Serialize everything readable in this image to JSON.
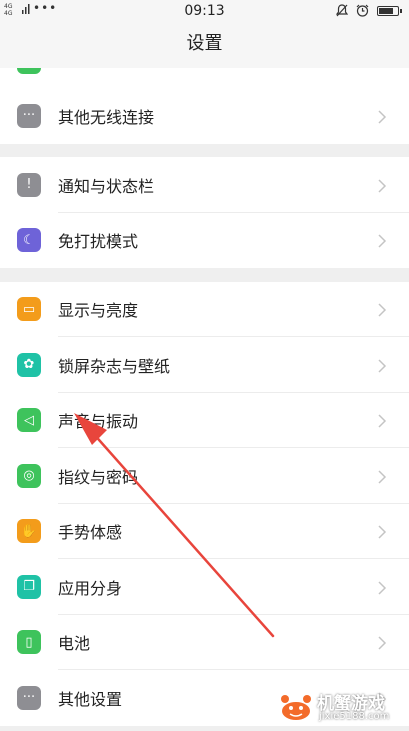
{
  "status_bar": {
    "network_top": "4G",
    "network_bottom": "4G",
    "overflow": "•••",
    "time": "09:13",
    "icons": [
      "mute-icon",
      "alarm-icon",
      "battery-icon"
    ],
    "battery_level": 0.85
  },
  "header": {
    "title": "设置"
  },
  "settings": {
    "group0": [
      {
        "label": "其他无线连接",
        "icon": "more-dots-icon",
        "color": "#8e8e93",
        "glyph": "···"
      }
    ],
    "group1": [
      {
        "label": "通知与状态栏",
        "icon": "notification-icon",
        "color": "#8e8e93",
        "glyph": "!"
      },
      {
        "label": "免打扰模式",
        "icon": "moon-icon",
        "color": "#6e63d8",
        "glyph": "☾"
      }
    ],
    "group2": [
      {
        "label": "显示与亮度",
        "icon": "display-icon",
        "color": "#f39c1b",
        "glyph": "▭"
      },
      {
        "label": "锁屏杂志与壁纸",
        "icon": "flower-icon",
        "color": "#1fc2a6",
        "glyph": "✿"
      },
      {
        "label": "声音与振动",
        "icon": "speaker-icon",
        "color": "#3ec35c",
        "glyph": "◁"
      },
      {
        "label": "指纹与密码",
        "icon": "fingerprint-icon",
        "color": "#3ec35c",
        "glyph": "◎"
      },
      {
        "label": "手势体感",
        "icon": "hand-icon",
        "color": "#f39c1b",
        "glyph": "✋"
      },
      {
        "label": "应用分身",
        "icon": "clone-app-icon",
        "color": "#1fc2a6",
        "glyph": "❐"
      },
      {
        "label": "电池",
        "icon": "battery-icon",
        "color": "#3ec35c",
        "glyph": "▯"
      },
      {
        "label": "其他设置",
        "icon": "more-dots-icon",
        "color": "#8e8e93",
        "glyph": "···"
      }
    ]
  },
  "watermark": {
    "name": "机蟹游戏",
    "url": "jixie5188.com"
  }
}
